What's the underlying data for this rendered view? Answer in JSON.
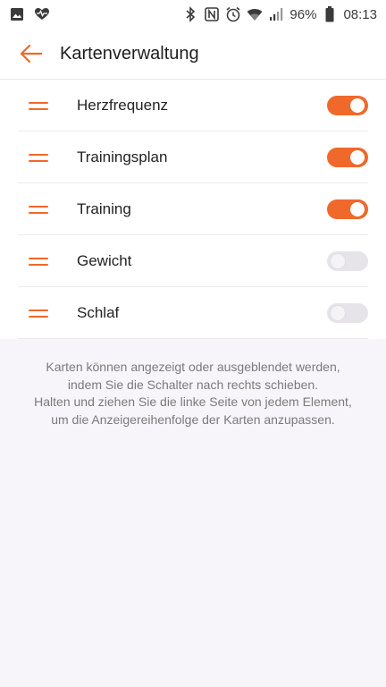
{
  "status_bar": {
    "battery_percent": "96%",
    "time": "08:13",
    "icons_left": [
      "gallery-icon",
      "heart-monitor-icon"
    ],
    "icons_right": [
      "bluetooth-icon",
      "nfc-icon",
      "alarm-icon",
      "wifi-icon",
      "signal-icon",
      "battery-icon"
    ]
  },
  "header": {
    "title": "Kartenverwaltung"
  },
  "cards": [
    {
      "label": "Herzfrequenz",
      "enabled": true
    },
    {
      "label": "Trainingsplan",
      "enabled": true
    },
    {
      "label": "Training",
      "enabled": true
    },
    {
      "label": "Gewicht",
      "enabled": false
    },
    {
      "label": "Schlaf",
      "enabled": false
    }
  ],
  "hint": {
    "line1": "Karten können angezeigt oder ausgeblendet werden,",
    "line2": "indem Sie die Schalter nach rechts schieben.",
    "line3": "Halten und ziehen Sie die linke Seite von jedem Element,",
    "line4": "um die Anzeigereihenfolge der Karten anzupassen."
  },
  "colors": {
    "accent": "#f0682a",
    "toggle_off": "#e6e4e8",
    "background": "#f8f5fa"
  }
}
